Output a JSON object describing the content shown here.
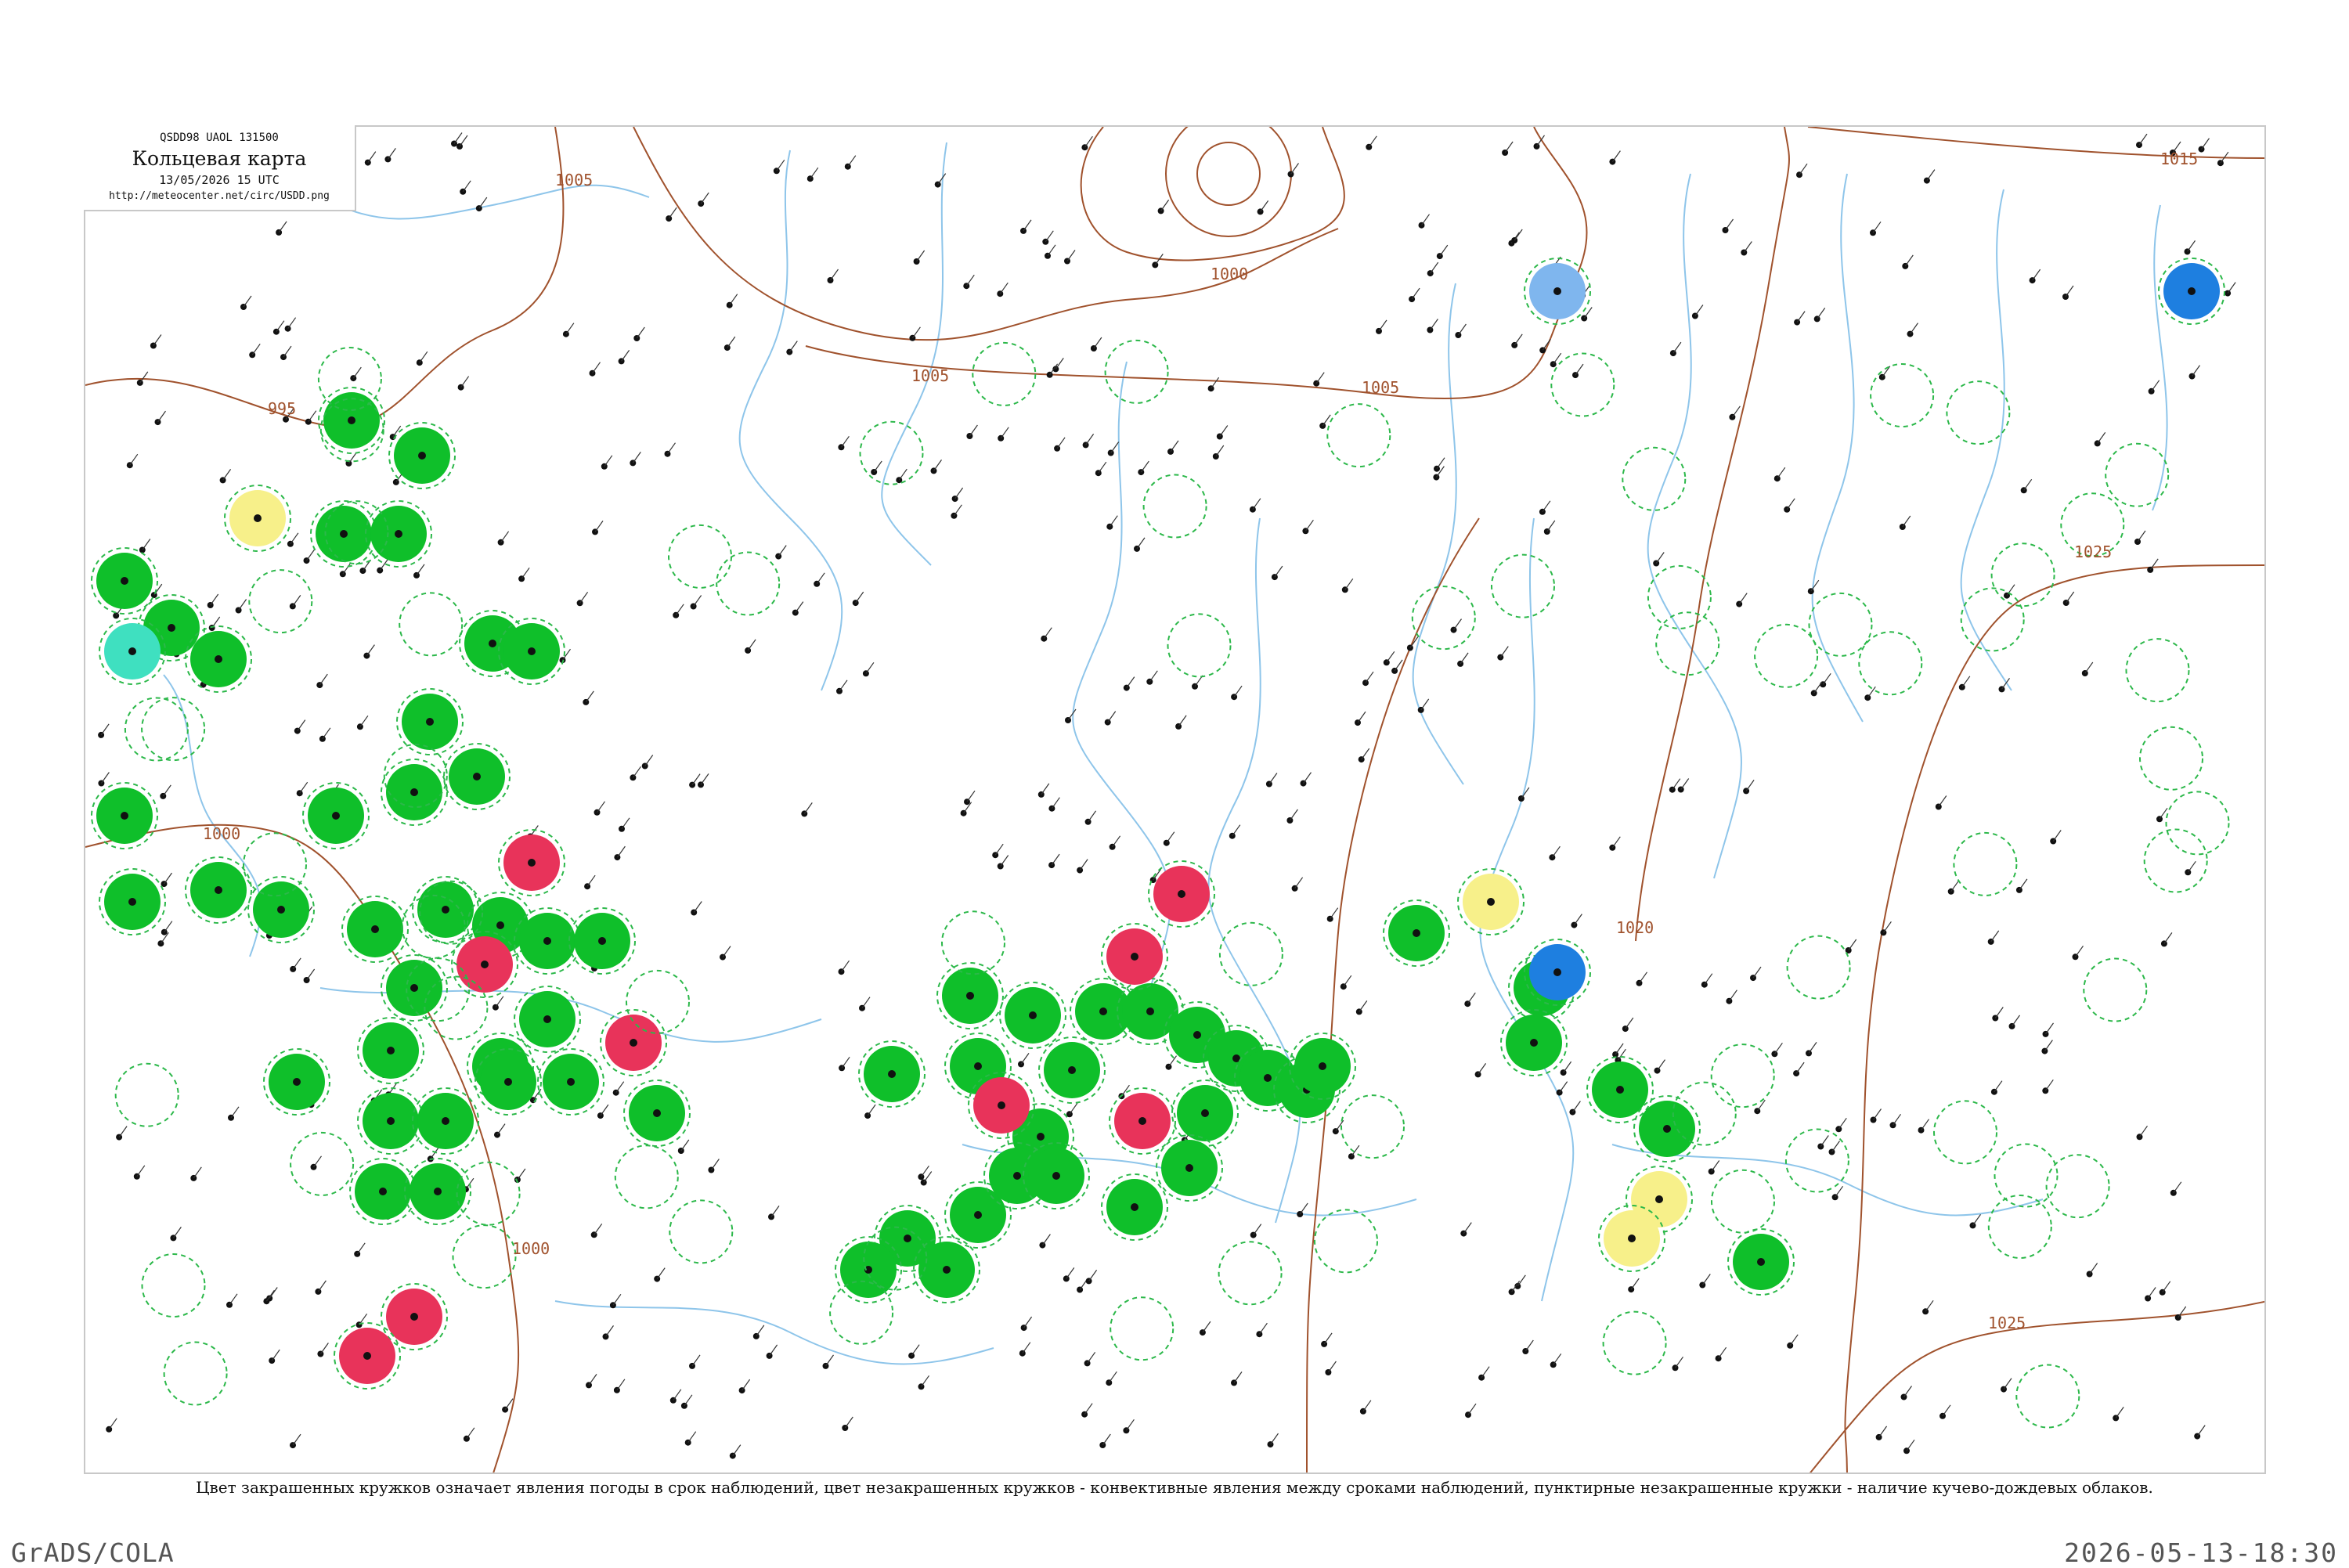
{
  "header": {
    "code": "QSDD98  UAOL  131500",
    "title": "Кольцевая карта",
    "date": "13/05/2026 15 UTC",
    "url": "http://meteocenter.net/circ/USDD.png"
  },
  "caption": "Цвет закрашенных кружков означает явления погоды в срок наблюдений, цвет незакрашенных кружков - конвективные явления между сроками наблюдений, пунктирные незакрашенные кружки - наличие кучево-дождевых облаков.",
  "footer": {
    "left": "GrADS/COLA",
    "right": "2026-05-13-18:30"
  },
  "colors": {
    "isobar": "#a0522d",
    "river": "#8ec5ea",
    "green": "#0fbf2a",
    "red": "#e8335a",
    "yellow": "#f7f08a",
    "blue": "#1e7fe0",
    "light_blue": "#7fb6ee",
    "cyan": "#3fe0c0",
    "dashed_green": "#2cb84a"
  },
  "isobars": [
    {
      "label": "995"
    },
    {
      "label": "1000"
    },
    {
      "label": "1000"
    },
    {
      "label": "1000"
    },
    {
      "label": "1005"
    },
    {
      "label": "1005"
    },
    {
      "label": "1005"
    },
    {
      "label": "1015"
    },
    {
      "label": "1020"
    },
    {
      "label": "1025"
    },
    {
      "label": "1025"
    }
  ],
  "weather_circles": {
    "green": 62,
    "red": 9,
    "yellow": 4,
    "blue": 2,
    "light_blue": 1,
    "cyan": 1
  }
}
